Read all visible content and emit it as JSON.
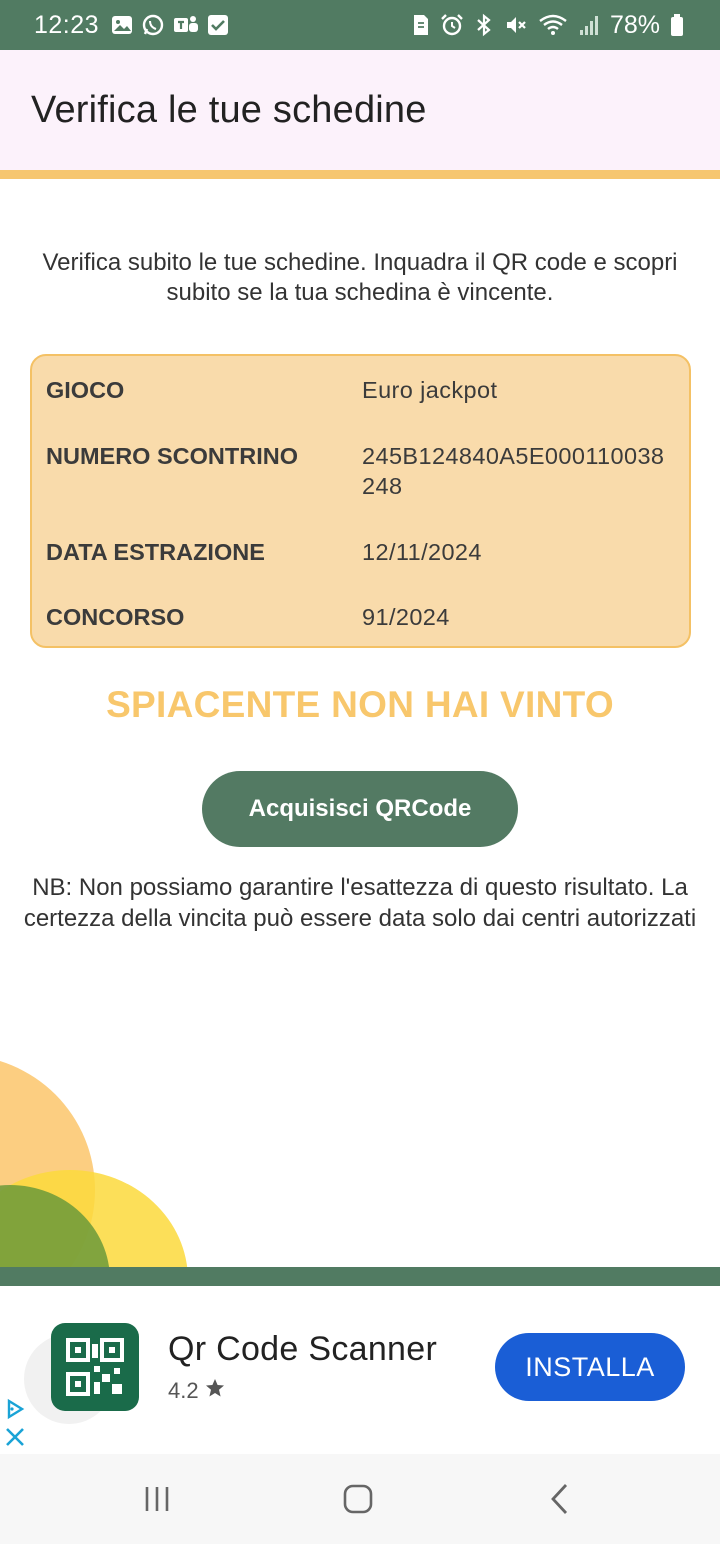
{
  "status_bar": {
    "time": "12:23",
    "battery": "78%",
    "left_icons": [
      "gallery-icon",
      "whatsapp-icon",
      "teams-icon",
      "checkbox-icon"
    ],
    "right_icons": [
      "sim-icon",
      "alarm-icon",
      "bluetooth-icon",
      "mute-icon",
      "wifi-icon",
      "signal-icon",
      "battery-icon"
    ]
  },
  "header": {
    "title": "Verifica le tue schedine"
  },
  "intro": "Verifica subito le tue schedine. Inquadra il QR code e scopri subito se la tua schedina è vincente.",
  "ticket": {
    "rows": [
      {
        "label": "GIOCO",
        "value": "Euro jackpot"
      },
      {
        "label": "NUMERO SCONTRINO",
        "value": "245B124840A5E000110038248"
      },
      {
        "label": "DATA ESTRAZIONE",
        "value": "12/11/2024"
      },
      {
        "label": "CONCORSO",
        "value": "91/2024"
      }
    ]
  },
  "result": "SPIACENTE NON HAI VINTO",
  "scan_button": "Acquisisci QRCode",
  "note": "NB: Non possiamo garantire l'esattezza di questo risultato. La certezza della vincita può essere data solo dai centri autorizzati",
  "ad": {
    "app_name": "Qr Code Scanner",
    "rating": "4.2",
    "install_label": "INSTALLA"
  },
  "colors": {
    "brand_green": "#517b62",
    "accent_orange": "#f6c670",
    "card_bg": "#f9dbab",
    "install_blue": "#1a5ed6"
  }
}
